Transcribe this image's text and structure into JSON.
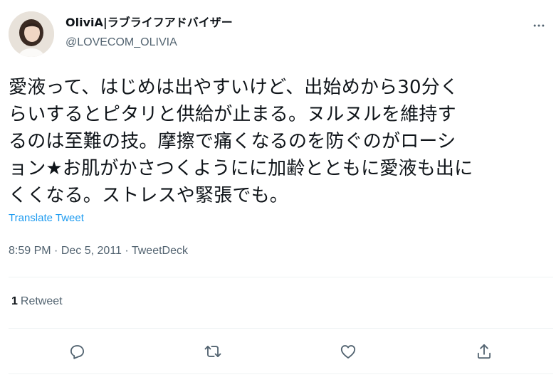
{
  "author": {
    "display_name": "OliviA|ラブライフアドバイザー",
    "handle": "@LOVECOM_OLIVIA"
  },
  "tweet": {
    "lines": [
      "愛液って、はじめは出やすいけど、出始めから30分く",
      "らいするとピタリと供給が止まる。ヌルヌルを維持す",
      "るのは至難の技。摩擦で痛くなるのを防ぐのがローシ",
      "ョン★お肌がかさつくようにに加齢とともに愛液も出に",
      "くくなる。ストレスや緊張でも。"
    ],
    "translate_label": "Translate Tweet",
    "time": "8:59 PM",
    "date": "Dec 5, 2011",
    "source": "TweetDeck",
    "separator": "·"
  },
  "stats": {
    "retweet_count": "1",
    "retweet_label": "Retweet"
  },
  "icons": {
    "more": "more-icon",
    "reply": "reply-icon",
    "retweet": "retweet-icon",
    "like": "like-icon",
    "share": "share-icon"
  },
  "colors": {
    "accent": "#1d9bf0",
    "text": "#0f1419",
    "secondary": "#536471",
    "divider": "#eff3f4"
  }
}
